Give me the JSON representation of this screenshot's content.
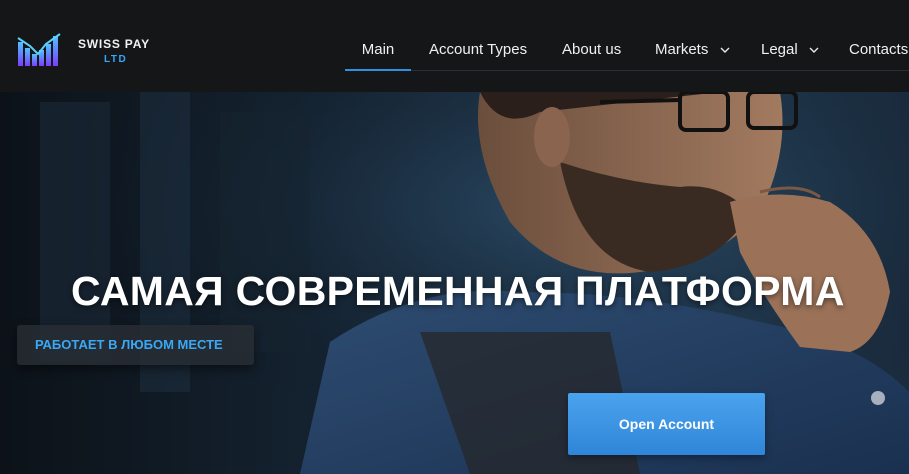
{
  "brand": {
    "name": "SWISS PAY",
    "sub": "LTD"
  },
  "nav": {
    "items": [
      {
        "label": "Main"
      },
      {
        "label": "Account Types"
      },
      {
        "label": "About us"
      },
      {
        "label": "Markets"
      },
      {
        "label": "Legal"
      },
      {
        "label": "Contacts"
      }
    ],
    "active_index": 0
  },
  "hero": {
    "headline": "САМАЯ СОВРЕМЕННАЯ ПЛАТФОРМА",
    "tagline": "РАБОТАЕТ В ЛЮБОМ МЕСТЕ",
    "cta_label": "Open Account"
  },
  "colors": {
    "accent": "#2f8fe0",
    "tagline": "#39a9f5",
    "header_bg": "#151618"
  }
}
